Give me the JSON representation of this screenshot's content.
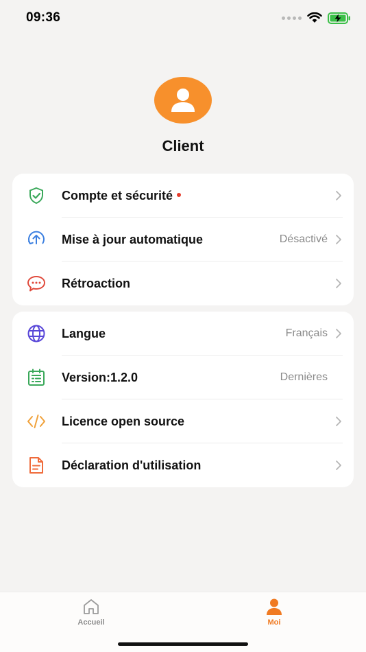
{
  "status_bar": {
    "time": "09:36",
    "icons": [
      "signal-dots-icon",
      "wifi-icon",
      "battery-charging-icon"
    ]
  },
  "profile": {
    "avatar_icon": "user-icon",
    "name": "Client"
  },
  "colors": {
    "accent": "#f7902c",
    "accent_text": "#f07a22",
    "security_green": "#3aa85a",
    "update_blue": "#3b7fe0",
    "feedback_red": "#e04a3c",
    "language_purple": "#5846d8",
    "version_green": "#3aa85a",
    "license_orange": "#f0a13a",
    "declaration_orange": "#ef6b3b"
  },
  "section1": {
    "items": [
      {
        "label": "Compte et sécurité",
        "value": "",
        "icon": "shield-check-icon",
        "badge": "red-dot"
      },
      {
        "label": "Mise à jour automatique",
        "value": "Désactivé",
        "icon": "upload-circle-icon"
      },
      {
        "label": "Rétroaction",
        "value": "",
        "icon": "chat-bubble-icon"
      }
    ]
  },
  "section2": {
    "items": [
      {
        "label": "Langue",
        "value": "Français",
        "icon": "globe-icon"
      },
      {
        "label": "Version:1.2.0",
        "value": "Dernières",
        "icon": "calendar-list-icon"
      },
      {
        "label": "Licence open source",
        "value": "",
        "icon": "code-icon"
      },
      {
        "label": "Déclaration d'utilisation",
        "value": "",
        "icon": "document-icon"
      }
    ]
  },
  "tabbar": {
    "tabs": [
      {
        "label": "Accueil",
        "icon": "home-icon",
        "active": false
      },
      {
        "label": "Moi",
        "icon": "person-icon",
        "active": true
      }
    ]
  }
}
